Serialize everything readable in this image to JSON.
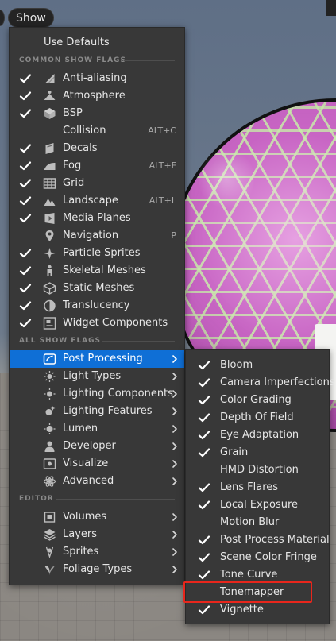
{
  "show_button": {
    "label": "Show"
  },
  "main_menu": {
    "use_defaults": "Use Defaults",
    "sections": {
      "common": "COMMON SHOW FLAGS",
      "all": "ALL SHOW FLAGS",
      "editor": "EDITOR"
    },
    "common_items": [
      {
        "label": "Anti-aliasing",
        "checked": true,
        "icon": "anti-aliasing-icon",
        "shortcut": ""
      },
      {
        "label": "Atmosphere",
        "checked": true,
        "icon": "atmosphere-icon",
        "shortcut": ""
      },
      {
        "label": "BSP",
        "checked": true,
        "icon": "bsp-icon",
        "shortcut": ""
      },
      {
        "label": "Collision",
        "checked": false,
        "icon": "collision-icon",
        "shortcut": "ALT+C"
      },
      {
        "label": "Decals",
        "checked": true,
        "icon": "decals-icon",
        "shortcut": ""
      },
      {
        "label": "Fog",
        "checked": true,
        "icon": "fog-icon",
        "shortcut": "ALT+F"
      },
      {
        "label": "Grid",
        "checked": true,
        "icon": "grid-icon",
        "shortcut": ""
      },
      {
        "label": "Landscape",
        "checked": true,
        "icon": "landscape-icon",
        "shortcut": "ALT+L"
      },
      {
        "label": "Media Planes",
        "checked": true,
        "icon": "media-planes-icon",
        "shortcut": ""
      },
      {
        "label": "Navigation",
        "checked": false,
        "icon": "navigation-icon",
        "shortcut": "P"
      },
      {
        "label": "Particle Sprites",
        "checked": true,
        "icon": "particle-sprites-icon",
        "shortcut": ""
      },
      {
        "label": "Skeletal Meshes",
        "checked": true,
        "icon": "skeletal-meshes-icon",
        "shortcut": ""
      },
      {
        "label": "Static Meshes",
        "checked": true,
        "icon": "static-meshes-icon",
        "shortcut": ""
      },
      {
        "label": "Translucency",
        "checked": true,
        "icon": "translucency-icon",
        "shortcut": ""
      },
      {
        "label": "Widget Components",
        "checked": true,
        "icon": "widget-components-icon",
        "shortcut": ""
      }
    ],
    "all_items": [
      {
        "label": "Post Processing",
        "icon": "post-processing-icon",
        "selected": true
      },
      {
        "label": "Light Types",
        "icon": "light-types-icon",
        "selected": false
      },
      {
        "label": "Lighting Components",
        "icon": "lighting-components-icon",
        "selected": false
      },
      {
        "label": "Lighting Features",
        "icon": "lighting-features-icon",
        "selected": false
      },
      {
        "label": "Lumen",
        "icon": "lumen-icon",
        "selected": false
      },
      {
        "label": "Developer",
        "icon": "developer-icon",
        "selected": false
      },
      {
        "label": "Visualize",
        "icon": "visualize-icon",
        "selected": false
      },
      {
        "label": "Advanced",
        "icon": "advanced-icon",
        "selected": false
      }
    ],
    "editor_items": [
      {
        "label": "Volumes",
        "icon": "volumes-icon"
      },
      {
        "label": "Layers",
        "icon": "layers-icon"
      },
      {
        "label": "Sprites",
        "icon": "sprites-icon"
      },
      {
        "label": "Foliage Types",
        "icon": "foliage-types-icon"
      }
    ]
  },
  "post_processing_menu": {
    "items": [
      {
        "label": "Bloom",
        "checked": true
      },
      {
        "label": "Camera Imperfections",
        "checked": true
      },
      {
        "label": "Color Grading",
        "checked": true
      },
      {
        "label": "Depth Of Field",
        "checked": true
      },
      {
        "label": "Eye Adaptation",
        "checked": true
      },
      {
        "label": "Grain",
        "checked": true
      },
      {
        "label": "HMD Distortion",
        "checked": false
      },
      {
        "label": "Lens Flares",
        "checked": true
      },
      {
        "label": "Local Exposure",
        "checked": true
      },
      {
        "label": "Motion Blur",
        "checked": false
      },
      {
        "label": "Post Process Material",
        "checked": true
      },
      {
        "label": "Scene Color Fringe",
        "checked": true
      },
      {
        "label": "Tone Curve",
        "checked": true
      },
      {
        "label": "Tonemapper",
        "checked": false
      },
      {
        "label": "Vignette",
        "checked": true
      }
    ],
    "highlighted_item": "Tonemapper"
  },
  "colors": {
    "menu_bg": "#383838",
    "selected_bg": "#0f6fd6",
    "highlight_border": "#e8261c",
    "check": "#ffffff"
  }
}
